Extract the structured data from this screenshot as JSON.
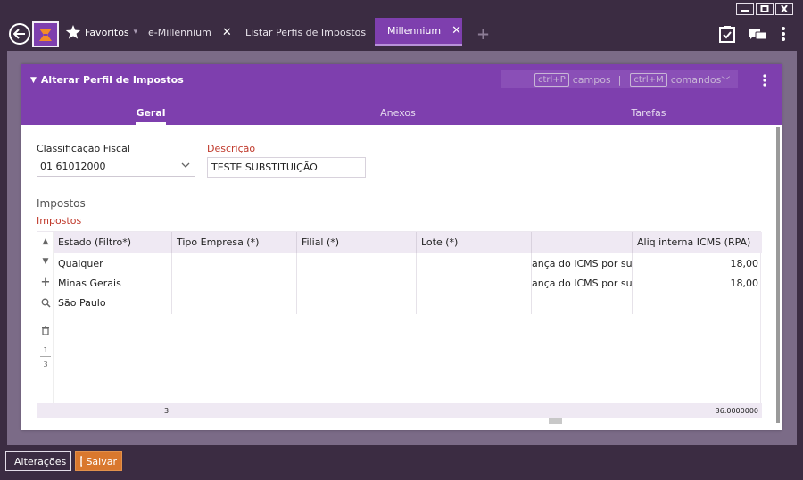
{
  "window": {
    "minimize": "minimize",
    "maximize": "maximize",
    "close": "close"
  },
  "topbar": {
    "favorites_label": "Favoritos",
    "tabs": [
      {
        "label": "e-Millennium"
      },
      {
        "label": "Listar Perfis de Impostos"
      },
      {
        "label": "Millennium"
      }
    ]
  },
  "panel": {
    "title": "Alterar Perfil de Impostos",
    "shortcut_fields_key": "ctrl+P",
    "shortcut_fields_label": "campos",
    "shortcut_separator": "|",
    "shortcut_commands_key": "ctrl+M",
    "shortcut_commands_label": "comandos",
    "tabs": [
      "Geral",
      "Anexos",
      "Tarefas"
    ],
    "active_tab": "Geral"
  },
  "form": {
    "classificacao_label": "Classificação Fiscal",
    "classificacao_value": "01 61012000",
    "descricao_label": "Descrição",
    "descricao_value": "TESTE SUBSTITUIÇÃO",
    "section_title": "Impostos",
    "subsection_title": "Impostos"
  },
  "grid": {
    "columns": [
      "Estado (Filtro*)",
      "Tipo Empresa (*)",
      "Filial (*)",
      "Lote (*)",
      "",
      "Aliq interna ICMS (RPA)"
    ],
    "rows": [
      {
        "estado": "Qualquer",
        "tipo": "",
        "filial": "",
        "lote": "",
        "col5": "ança do ICMS por su...",
        "aliq": "18,00"
      },
      {
        "estado": "Minas Gerais",
        "tipo": "",
        "filial": "",
        "lote": "",
        "col5": "ança do ICMS por su...",
        "aliq": "18,00"
      },
      {
        "estado": "São Paulo",
        "tipo": "",
        "filial": "",
        "lote": "",
        "col5": "",
        "aliq": ""
      }
    ],
    "pager": {
      "current": "1",
      "total": "3"
    },
    "footer": {
      "count": "3",
      "sum": "36.0000000"
    }
  },
  "bottom": {
    "changes_label": "Alterações",
    "save_label": "Salvar"
  },
  "colors": {
    "accent": "#7e3fae",
    "background": "#3b2c42",
    "save": "#d9782e",
    "required": "#c0392b"
  }
}
